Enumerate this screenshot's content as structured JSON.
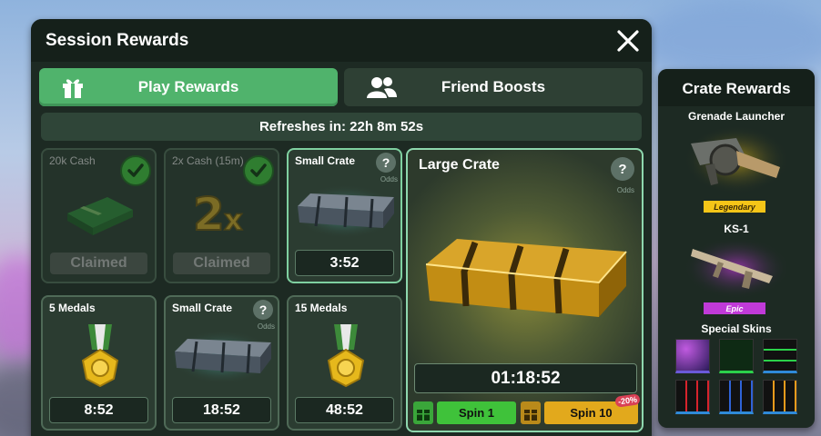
{
  "background": {
    "colors": [
      "#8fb3dd",
      "#c9b9d8",
      "#7d7f96"
    ]
  },
  "session": {
    "title": "Session Rewards",
    "close_icon": "close-icon"
  },
  "tabs": [
    {
      "label": "Play Rewards",
      "icon": "gift-icon",
      "active": true
    },
    {
      "label": "Friend Boosts",
      "icon": "friends-icon",
      "active": false
    }
  ],
  "refresh": {
    "label": "Refreshes in: 22h 8m 52s"
  },
  "rewards": [
    {
      "title": "20k Cash",
      "status": "Claimed",
      "icon": "cash-stack-icon"
    },
    {
      "title": "2x Cash (15m)",
      "status": "Claimed",
      "icon": "2x-icon"
    },
    {
      "title": "Small Crate",
      "timer": "3:52",
      "help": "?",
      "odds": "Odds",
      "icon": "crate-icon"
    },
    {
      "title": "5 Medals",
      "timer": "8:52",
      "icon": "medal-icon"
    },
    {
      "title": "Small Crate",
      "timer": "18:52",
      "help": "?",
      "odds": "Odds",
      "icon": "crate-icon"
    },
    {
      "title": "15 Medals",
      "timer": "48:52",
      "icon": "medal-icon"
    }
  ],
  "large_crate": {
    "title": "Large Crate",
    "help": "?",
    "odds": "Odds",
    "timer": "01:18:52",
    "spin1": "Spin 1",
    "spin10": "Spin 10",
    "discount": "-20%"
  },
  "crate_rewards": {
    "title": "Crate Rewards",
    "items": [
      {
        "name": "Grenade Launcher",
        "rarity": "Legendary",
        "rarity_color": "#f5c518"
      },
      {
        "name": "KS-1",
        "rarity": "Epic",
        "rarity_color": "#c03ad8"
      }
    ],
    "skins_title": "Special Skins",
    "skins": [
      {
        "name": "galaxy-skin",
        "color": "#5b3fa8"
      },
      {
        "name": "matrix-skin",
        "color": "#1a5a2a"
      },
      {
        "name": "green-grid-skin",
        "color": "#2bd14a"
      },
      {
        "name": "red-grid-skin",
        "color": "#d8232c"
      },
      {
        "name": "blue-grid-skin",
        "color": "#2f63d8"
      },
      {
        "name": "orange-grid-skin",
        "color": "#e89a1c"
      }
    ]
  }
}
